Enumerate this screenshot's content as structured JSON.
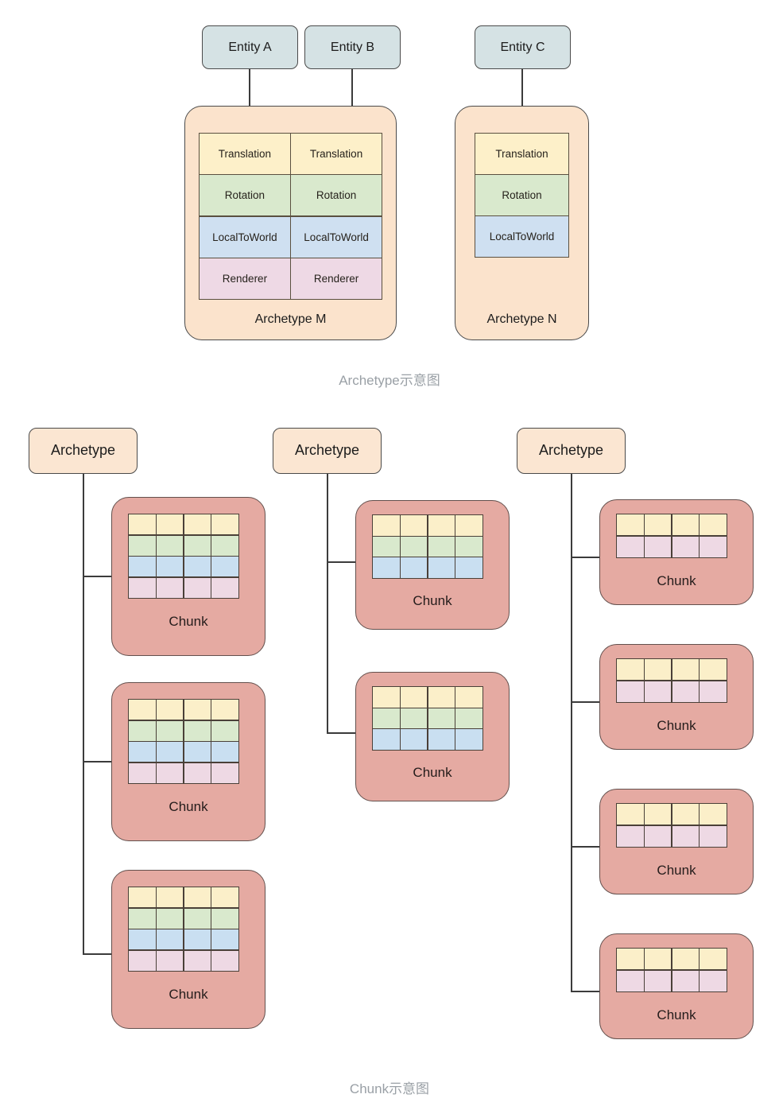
{
  "figure_one": {
    "caption": "Archetype示意图",
    "entities": [
      {
        "label": "Entity A"
      },
      {
        "label": "Entity B"
      },
      {
        "label": "Entity C"
      }
    ],
    "archetypes": [
      {
        "label": "Archetype M",
        "entity_count": 2,
        "components": [
          "Translation",
          "Rotation",
          "LocalToWorld",
          "Renderer"
        ],
        "columns": [
          [
            "Translation",
            "Rotation",
            "LocalToWorld",
            "Renderer"
          ],
          [
            "Translation",
            "Rotation",
            "LocalToWorld",
            "Renderer"
          ]
        ]
      },
      {
        "label": "Archetype N",
        "entity_count": 1,
        "components": [
          "Translation",
          "Rotation",
          "LocalToWorld"
        ],
        "columns": [
          [
            "Translation",
            "Rotation",
            "LocalToWorld"
          ]
        ]
      }
    ]
  },
  "figure_two": {
    "caption": "Chunk示意图",
    "groups": [
      {
        "archetype_label": "Archetype",
        "chunk_label": "Chunk",
        "chunk_count": 3,
        "grid_rows": 4,
        "grid_cols": 4,
        "row_colors": [
          "yellow",
          "green",
          "blue",
          "pink"
        ],
        "chunks": [
          {
            "label": "Chunk"
          },
          {
            "label": "Chunk"
          },
          {
            "label": "Chunk"
          }
        ]
      },
      {
        "archetype_label": "Archetype",
        "chunk_label": "Chunk",
        "chunk_count": 2,
        "grid_rows": 3,
        "grid_cols": 4,
        "row_colors": [
          "yellow",
          "green",
          "blue"
        ],
        "chunks": [
          {
            "label": "Chunk"
          },
          {
            "label": "Chunk"
          }
        ]
      },
      {
        "archetype_label": "Archetype",
        "chunk_label": "Chunk",
        "chunk_count": 4,
        "grid_rows": 2,
        "grid_cols": 4,
        "row_colors": [
          "yellow",
          "pink"
        ],
        "chunks": [
          {
            "label": "Chunk"
          },
          {
            "label": "Chunk"
          },
          {
            "label": "Chunk"
          },
          {
            "label": "Chunk"
          }
        ]
      }
    ]
  },
  "colors": {
    "entity_fill": "#d5e2e4",
    "archetype_fill": "#fbe3cc",
    "archetype_node_fill": "#fbe6d2",
    "chunk_fill": "#e5aaa2",
    "component_translation": "#fdf0c9",
    "component_rotation": "#d9e9cd",
    "component_localtoworld": "#cfe0f1",
    "component_renderer": "#eed9e5",
    "line": "#3b3b3b",
    "caption_text": "#9aa0a6"
  }
}
